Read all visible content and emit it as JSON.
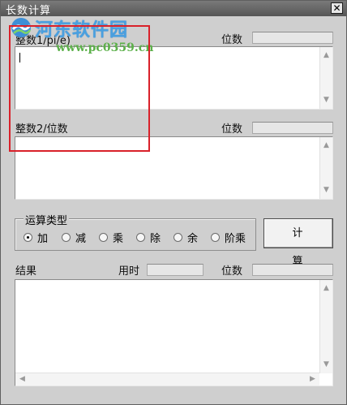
{
  "window": {
    "title": "长数计算",
    "close_glyph": "✕"
  },
  "watermark": {
    "name": "河东软件园",
    "url": "www.pc0359.cn",
    "icon": "river-logo-icon"
  },
  "input1": {
    "label": "整数1/pi/e)",
    "digits_label": "位数",
    "digits_value": "",
    "content": ""
  },
  "input2": {
    "label": "整数2/位数",
    "digits_label": "位数",
    "digits_value": "",
    "content": ""
  },
  "operation": {
    "group_label": "运算类型",
    "options": [
      {
        "label": "加",
        "checked": true
      },
      {
        "label": "减",
        "checked": false
      },
      {
        "label": "乘",
        "checked": false
      },
      {
        "label": "除",
        "checked": false
      },
      {
        "label": "余",
        "checked": false
      },
      {
        "label": "阶乘",
        "checked": false
      }
    ]
  },
  "calc_button": {
    "label": "计算"
  },
  "result": {
    "label": "结果",
    "time_label": "用时",
    "time_value": "",
    "digits_label": "位数",
    "digits_value": "",
    "content": ""
  },
  "scroll_icons": {
    "up": "▲",
    "down": "▼",
    "left": "◀",
    "right": "▶"
  },
  "colors": {
    "annotation": "#d9212a",
    "titlebar": "#666666",
    "watermark_blue": "#4aa0e0",
    "watermark_green": "#5cb04a"
  }
}
